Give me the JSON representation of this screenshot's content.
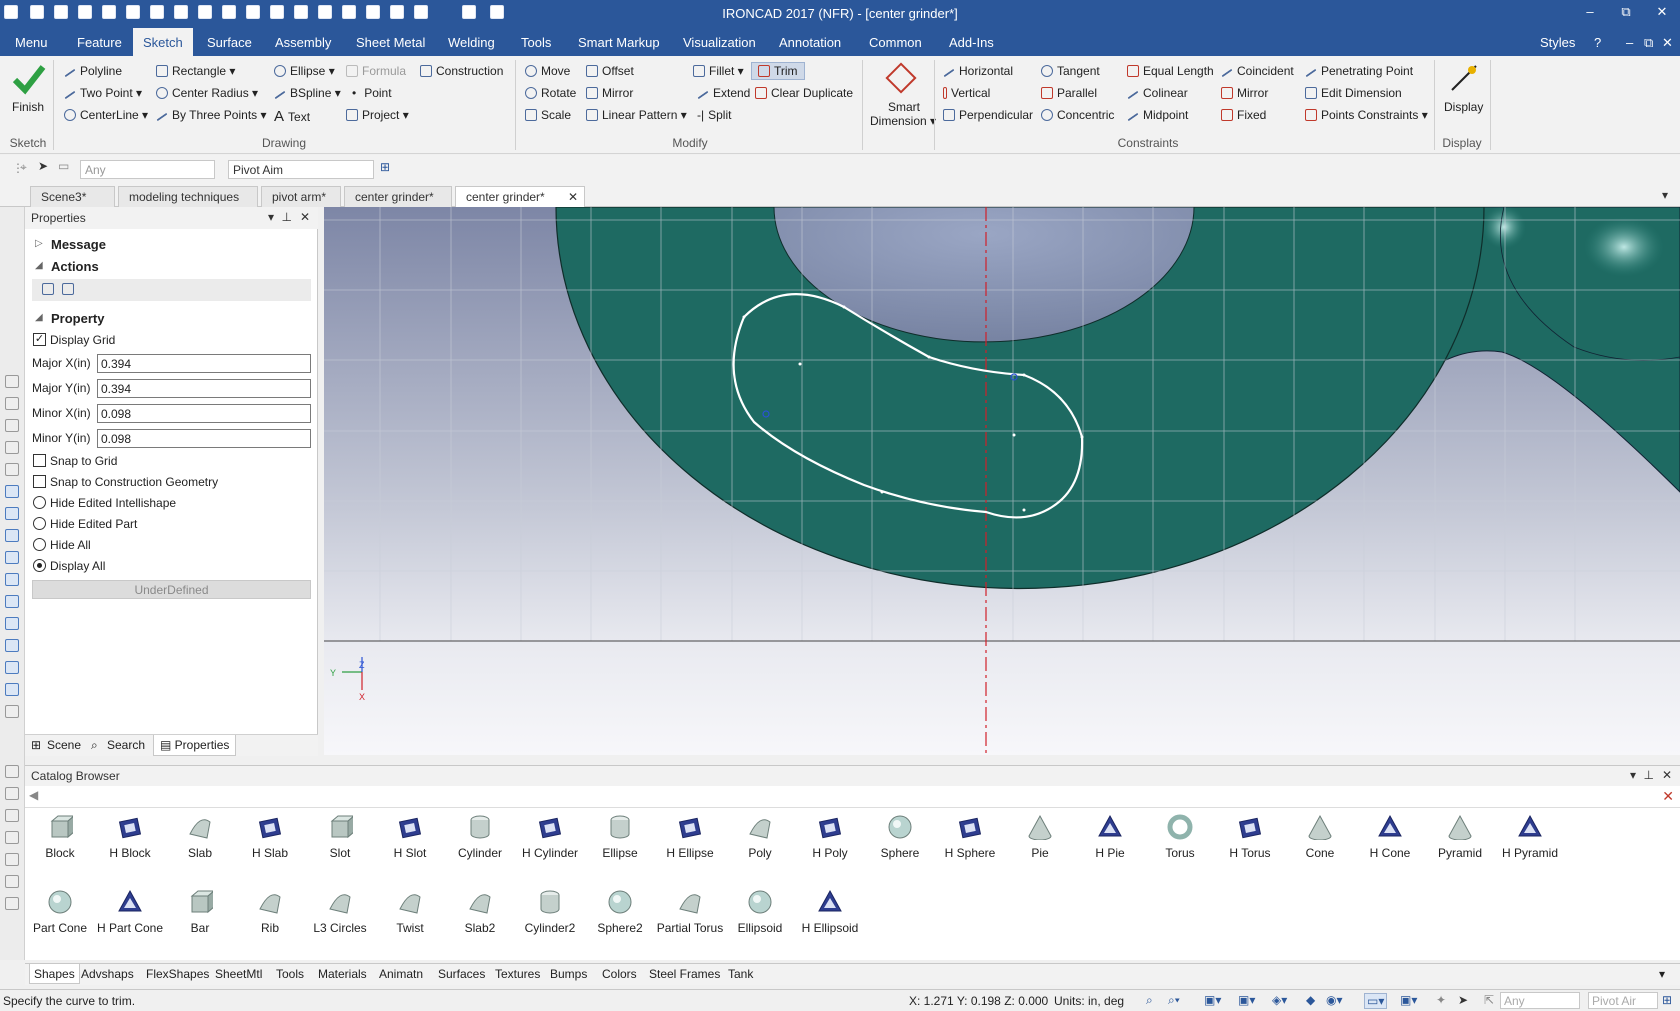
{
  "window": {
    "title": "IRONCAD 2017 (NFR) - [center grinder*]",
    "controls": [
      "–",
      "⧉",
      "✕"
    ]
  },
  "menu": {
    "tabs": [
      "Menu",
      "Feature",
      "Sketch",
      "Surface",
      "Assembly",
      "Sheet Metal",
      "Welding",
      "Tools",
      "Smart Markup",
      "Visualization",
      "Annotation",
      "Common",
      "Add-Ins"
    ],
    "active": "Sketch",
    "styles": "Styles"
  },
  "ribbon": {
    "finish": "Finish",
    "drawing": [
      "Polyline",
      "Two Point",
      "CenterLine",
      "Rectangle",
      "Center Radius",
      "By Three Points",
      "Ellipse",
      "BSpline",
      "Text",
      "Formula",
      "Point",
      "Project",
      "Construction"
    ],
    "modify": [
      "Move",
      "Rotate",
      "Scale",
      "Offset",
      "Mirror",
      "Linear Pattern",
      "Fillet",
      "Extend",
      "Split",
      "Trim",
      "Clear Duplicate"
    ],
    "smart_dimension": [
      "Smart",
      "Dimension"
    ],
    "constraints": [
      "Horizontal",
      "Vertical",
      "Perpendicular",
      "Tangent",
      "Parallel",
      "Concentric",
      "Equal Length",
      "Colinear",
      "Midpoint",
      "Coincident",
      "Mirror",
      "Fixed",
      "Penetrating Point",
      "Edit Dimension",
      "Points Constraints"
    ],
    "display": "Display",
    "groups": {
      "sketch": "Sketch",
      "drawing": "Drawing",
      "modify": "Modify",
      "constraints": "Constraints",
      "display": "Display"
    }
  },
  "toolbar2": {
    "filter": "Any",
    "mode": "Pivot Aim"
  },
  "doc_tabs": [
    "Scene3*",
    "modeling techniques",
    "pivot arm*",
    "center grinder*",
    "center grinder*"
  ],
  "properties": {
    "title": "Properties",
    "sections": {
      "message": "Message",
      "actions": "Actions",
      "property": "Property"
    },
    "display_grid": "Display Grid",
    "fields": [
      {
        "label": "Major X(in)",
        "value": "0.394"
      },
      {
        "label": "Major Y(in)",
        "value": "0.394"
      },
      {
        "label": "Minor X(in)",
        "value": "0.098"
      },
      {
        "label": "Minor Y(in)",
        "value": "0.098"
      }
    ],
    "snap_grid": "Snap to Grid",
    "snap_construction": "Snap to Construction Geometry",
    "radios": [
      "Hide Edited Intellishape",
      "Hide Edited Part",
      "Hide All",
      "Display All"
    ],
    "radio_selected": "Display All",
    "status_button": "UnderDefined",
    "tabs": [
      "Scene",
      "Search",
      "Properties"
    ]
  },
  "triad": {
    "z": "Z",
    "y": "Y",
    "x": "X"
  },
  "catalog": {
    "title": "Catalog Browser",
    "items_row1": [
      "Block",
      "H Block",
      "Slab",
      "H Slab",
      "Slot",
      "H Slot",
      "Cylinder",
      "H Cylinder",
      "Ellipse",
      "H Ellipse",
      "Poly",
      "H Poly",
      "Sphere",
      "H Sphere",
      "Pie",
      "H Pie",
      "Torus",
      "H Torus",
      "Cone",
      "H Cone",
      "Pyramid",
      "H Pyramid"
    ],
    "items_row2": [
      "Part Cone",
      "H Part Cone",
      "Bar",
      "Rib",
      "L3 Circles",
      "Twist",
      "Slab2",
      "Cylinder2",
      "Sphere2",
      "Partial Torus",
      "Ellipsoid",
      "H Ellipsoid"
    ],
    "tabs": [
      "Shapes",
      "Advshaps",
      "FlexShapes",
      "SheetMtl",
      "Tools",
      "Materials",
      "Animatn",
      "Surfaces",
      "Textures",
      "Bumps",
      "Colors",
      "Steel Frames",
      "Tank"
    ]
  },
  "status": {
    "message": "Specify the curve to trim.",
    "coords": "X: 1.271 Y: 0.198 Z: 0.000",
    "units": "Units: in, deg",
    "filter": "Any",
    "mode": "Pivot Air"
  },
  "colors": {
    "title_blue": "#2b579a",
    "part_teal": "#1e6a62",
    "sketch_white": "#ffffff",
    "axis_red": "#d0202a"
  }
}
